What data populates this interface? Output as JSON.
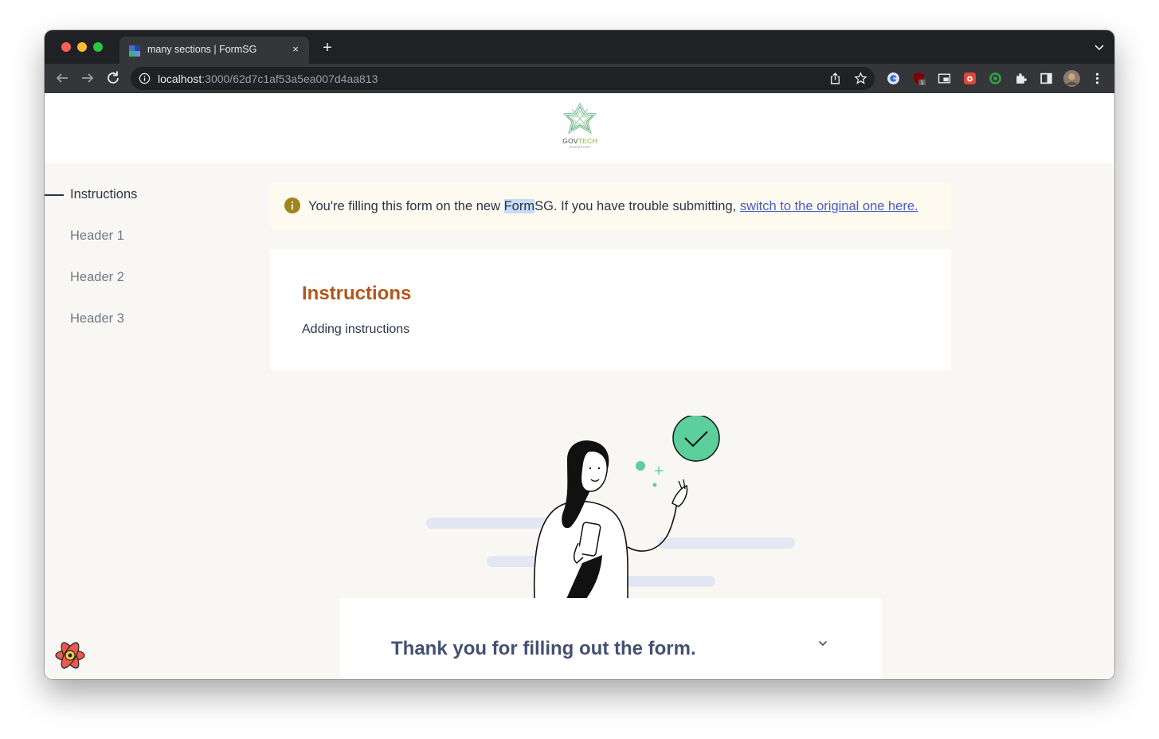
{
  "browser": {
    "tab_title": "many sections | FormSG",
    "tab_close": "×",
    "new_tab": "+",
    "url_host": "localhost",
    "url_path": ":3000/62d7c1af53a5ea007d4aa813"
  },
  "logo": {
    "text_gov": "GOV",
    "text_tech": "TECH",
    "subtext": "SINGAPORE"
  },
  "sidebar": {
    "items": [
      {
        "label": "Instructions"
      },
      {
        "label": "Header 1"
      },
      {
        "label": "Header 2"
      },
      {
        "label": "Header 3"
      }
    ]
  },
  "banner": {
    "text_before": "You're filling this form on the new ",
    "text_highlight": "Form",
    "text_after": "SG. If you have trouble submitting, ",
    "link": "switch to the original one here."
  },
  "instructions": {
    "title": "Instructions",
    "body": "Adding instructions"
  },
  "end_page": {
    "title": "Thank you for filling out the form."
  },
  "colors": {
    "accent_heading": "#b2571c",
    "link": "#4a5bc4",
    "success": "#5ccf9d"
  }
}
